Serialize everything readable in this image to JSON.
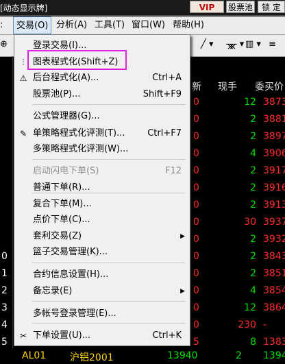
{
  "window": {
    "title": "[动态显示牌]"
  },
  "titlebar": {
    "vip": "VIP",
    "pool": "股票池",
    "lock": "锁 定"
  },
  "menubar": {
    "items": [
      "交易(O)",
      "分析(A)",
      "工具(T)",
      "窗口(W)",
      "帮助(H)"
    ]
  },
  "table": {
    "headers": [
      "新",
      "现手",
      "委买价"
    ],
    "rows": [
      {
        "left": "",
        "mark": "0",
        "qty": "12",
        "qty_color": "green",
        "bid": "3873.0"
      },
      {
        "left": "",
        "mark": "0",
        "qty": "2",
        "qty_color": "green",
        "bid": "3881.0"
      },
      {
        "left": "",
        "mark": "0",
        "qty": "2",
        "qty_color": "green",
        "bid": "3897.0"
      },
      {
        "left": "",
        "mark": "0",
        "qty": "4",
        "qty_color": "green",
        "bid": "3906.0"
      },
      {
        "left": "",
        "mark": "0",
        "qty": "2",
        "qty_color": "green",
        "bid": "3917.0"
      },
      {
        "left": "",
        "mark": "0",
        "qty": "2",
        "qty_color": "green",
        "bid": "3916.0"
      },
      {
        "left": "",
        "mark": "0",
        "qty": "2",
        "qty_color": "green",
        "bid": "3913.0"
      },
      {
        "left": "",
        "mark": "0",
        "qty": "30",
        "qty_color": "red",
        "bid": "3937.0"
      },
      {
        "left": "",
        "mark": "0",
        "qty": "2",
        "qty_color": "green",
        "bid": "3932.0"
      },
      {
        "left": "0",
        "mark": "0",
        "qty": "2",
        "qty_color": "green",
        "bid": "3843.0"
      },
      {
        "left": "1",
        "mark": "0",
        "qty": "2",
        "qty_color": "green",
        "bid": "3851.0"
      },
      {
        "left": "2",
        "mark": "0",
        "qty": "4",
        "qty_color": "green",
        "bid": "3854.0"
      },
      {
        "left": "3",
        "mark": "0",
        "qty": "12",
        "qty_color": "green",
        "bid": "3864.0"
      },
      {
        "left": "4",
        "mark": "0",
        "qty": "230",
        "qty_color": "red",
        "bid": "-"
      },
      {
        "left": "5",
        "mark": "5",
        "qty": "8",
        "qty_color": "green",
        "bid": "1383"
      }
    ],
    "bottom": {
      "code": "AL01",
      "name": "沪铝2001",
      "price": "13940",
      "qty": "2",
      "bid": "1394"
    }
  },
  "menu": {
    "items": [
      {
        "label": "登录交易(I)...",
        "shortcut": "",
        "icon": "",
        "submenu": false,
        "disabled": false
      },
      {
        "label": "图表程式化(Shift+Z)",
        "shortcut": "",
        "icon": "chart",
        "submenu": false,
        "disabled": false
      },
      {
        "label": "后台程式化(A)...",
        "shortcut": "Ctrl+A",
        "icon": "warn",
        "submenu": false,
        "disabled": false
      },
      {
        "label": "股票池(P)...",
        "shortcut": "Shift+F9",
        "icon": "",
        "submenu": false,
        "disabled": false
      },
      {
        "label": "公式管理器(G)...",
        "shortcut": "",
        "icon": "",
        "submenu": false,
        "disabled": false
      },
      {
        "label": "单策略程式化评测(T)...",
        "shortcut": "Ctrl+F7",
        "icon": "pen",
        "submenu": false,
        "disabled": false
      },
      {
        "label": "多策略程式化评测(W)...",
        "shortcut": "",
        "icon": "",
        "submenu": false,
        "disabled": false
      },
      {
        "label": "启动闪电下单(S)",
        "shortcut": "F12",
        "icon": "",
        "submenu": false,
        "disabled": true
      },
      {
        "label": "普通下单(R)...",
        "shortcut": "",
        "icon": "",
        "submenu": false,
        "disabled": false
      },
      {
        "label": "复合下单(M)...",
        "shortcut": "",
        "icon": "",
        "submenu": false,
        "disabled": false
      },
      {
        "label": "点价下单(C)...",
        "shortcut": "",
        "icon": "",
        "submenu": false,
        "disabled": false
      },
      {
        "label": "套利交易(Z)",
        "shortcut": "",
        "icon": "",
        "submenu": true,
        "disabled": false
      },
      {
        "label": "篮子交易管理(K)...",
        "shortcut": "",
        "icon": "",
        "submenu": false,
        "disabled": false
      },
      {
        "label": "合约信息设置(H)...",
        "shortcut": "",
        "icon": "",
        "submenu": false,
        "disabled": false
      },
      {
        "label": "备忘录(E)",
        "shortcut": "",
        "icon": "",
        "submenu": true,
        "disabled": false
      },
      {
        "label": "多帐号登录管理(E)...",
        "shortcut": "",
        "icon": "",
        "submenu": false,
        "disabled": false
      },
      {
        "label": "下单设置(U)...",
        "shortcut": "Ctrl+K",
        "icon": "tool",
        "submenu": false,
        "disabled": false
      }
    ]
  },
  "colors": {
    "highlight": "#e020e0",
    "green": "#00e000",
    "red": "#ff2a2a"
  }
}
